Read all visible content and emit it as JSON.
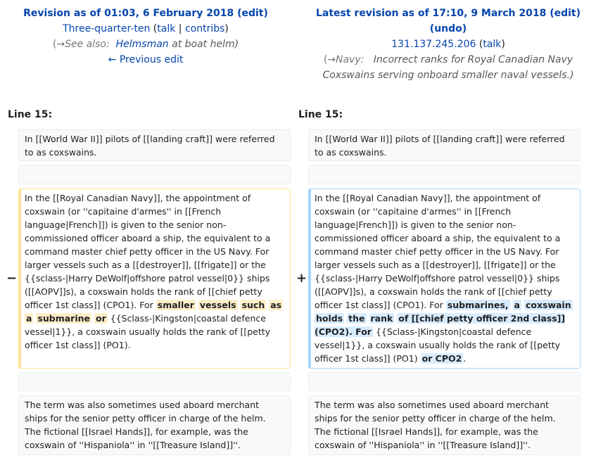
{
  "left_header": {
    "title_prefix": "Revision as of 01:03, 6 February 2018",
    "open_paren": " (",
    "edit_label": "edit",
    "close_paren": ")",
    "user": "Three-quarter-ten",
    "talk_open": " (",
    "talk_label": "talk",
    "sep": " | ",
    "contribs_label": "contribs",
    "talk_close": ")",
    "summary_arrow": "(→",
    "summary_section": "See also:",
    "summary_link": "Helmsman",
    "summary_rest": " at boat helm)",
    "prev_edit": "← Previous edit"
  },
  "right_header": {
    "title_prefix": "Latest revision as of 17:10, 9 March 2018",
    "open_paren": " (",
    "edit_label": "edit",
    "close_paren": ")",
    "undo_open": "(",
    "undo_label": "undo",
    "undo_close": ")",
    "user": "131.137.245.206",
    "talk_open": " (",
    "talk_label": "talk",
    "talk_close": ")",
    "summary_arrow": "(→",
    "summary_section": "Navy:",
    "summary_rest_1": "Incorrect ranks for Royal Canadian Navy",
    "summary_rest_2": "Coxswains serving onboard smaller naval vessels.)"
  },
  "line_labels": {
    "left": "Line 15:",
    "right": "Line 15:"
  },
  "markers": {
    "minus": "−",
    "plus": "+"
  },
  "context": {
    "p1": "In [[World War II]] pilots of [[landing craft]] were referred to as coxswains.",
    "p3": "The term was also sometimes used aboard merchant ships for the senior petty officer in charge of the helm. The fictional [[Israel Hands]], for example, was the coxswain of ''Hispaniola'' in ''[[Treasure Island]]''."
  },
  "deleted": {
    "text_1": "In the [[Royal Canadian Navy]], the appointment of coxswain (or ''capitaine d'armes'' in [[French language|French]]) is given to the senior non-commissioned officer aboard a ship, the equivalent to a command master chief petty officer in the US Navy. For larger vessels such as a [[destroyer]], [[frigate]] or the {{sclass-|Harry DeWolf|offshore patrol vessel|0}} ships ([[AOPV]]s), a coxswain holds the rank of [[chief petty officer 1st class]] (CPO1).  For ",
    "hl_1": "smaller",
    "hl_2": "vessels",
    "hl_3": "such",
    "hl_4": "as",
    "hl_5": "a",
    "hl_6": "submarine",
    "hl_7": "or",
    "text_2": " {{Sclass-|Kingston|coastal defence vessel|1}}, a coxswain usually holds the rank of [[petty officer 1st class]] (PO1)."
  },
  "added": {
    "text_1": "In the [[Royal Canadian Navy]], the appointment of coxswain (or ''capitaine d'armes'' in [[French language|French]]) is given to the senior non-commissioned officer aboard a ship, the equivalent to a command master chief petty officer in the US Navy. For larger vessels such as a [[destroyer]], [[frigate]] or the {{sclass-|Harry DeWolf|offshore patrol vessel|0}} ships ([[AOPV]]s), a coxswain holds the rank of [[chief petty officer 1st class]] (CPO1).  For ",
    "hl_1": "submarines,",
    "hl_2": "a",
    "hl_3": "coxswain",
    "hl_4": "holds",
    "hl_5": "the",
    "hl_6": "rank",
    "hl_7": "of [[chief petty officer 2nd class]] (CPO2).  For",
    "text_2": " {{Sclass-|Kingston|coastal defence vessel|1}}, a coxswain usually holds the rank of [[petty officer 1st class]] (PO1) ",
    "hl_8": "or CPO2",
    "text_3": "."
  }
}
